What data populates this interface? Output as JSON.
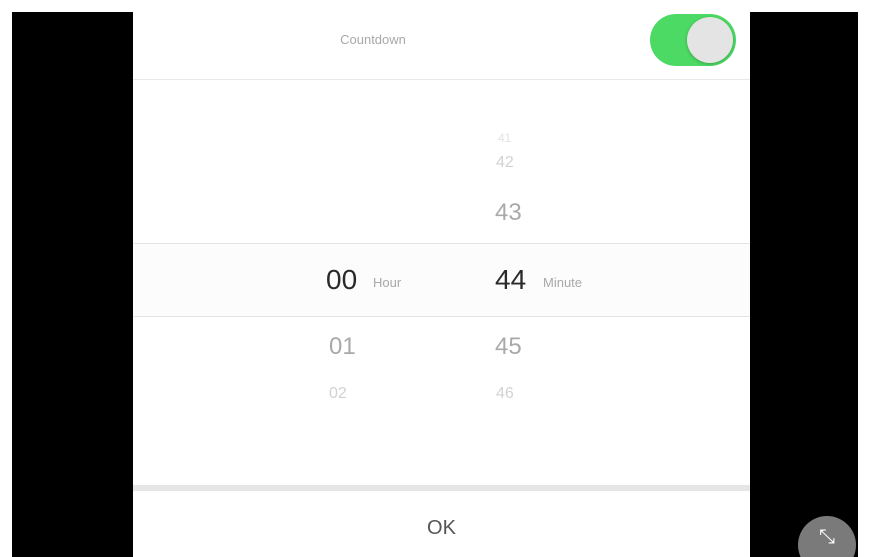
{
  "header": {
    "title": "Countdown",
    "toggle_on": true
  },
  "picker": {
    "hour": {
      "above": [
        "",
        ""
      ],
      "selected": "00",
      "below": [
        "01",
        "02"
      ],
      "unit": "Hour"
    },
    "minute": {
      "above": [
        "41",
        "42",
        "43"
      ],
      "selected": "44",
      "below": [
        "45",
        "46"
      ],
      "unit": "Minute"
    }
  },
  "footer": {
    "ok_label": "OK"
  },
  "fab": {
    "icon": "collapse-arrows-icon",
    "glyph": "⤡"
  },
  "colors": {
    "toggle_on": "#4cd964",
    "side_bars": "#000000"
  }
}
